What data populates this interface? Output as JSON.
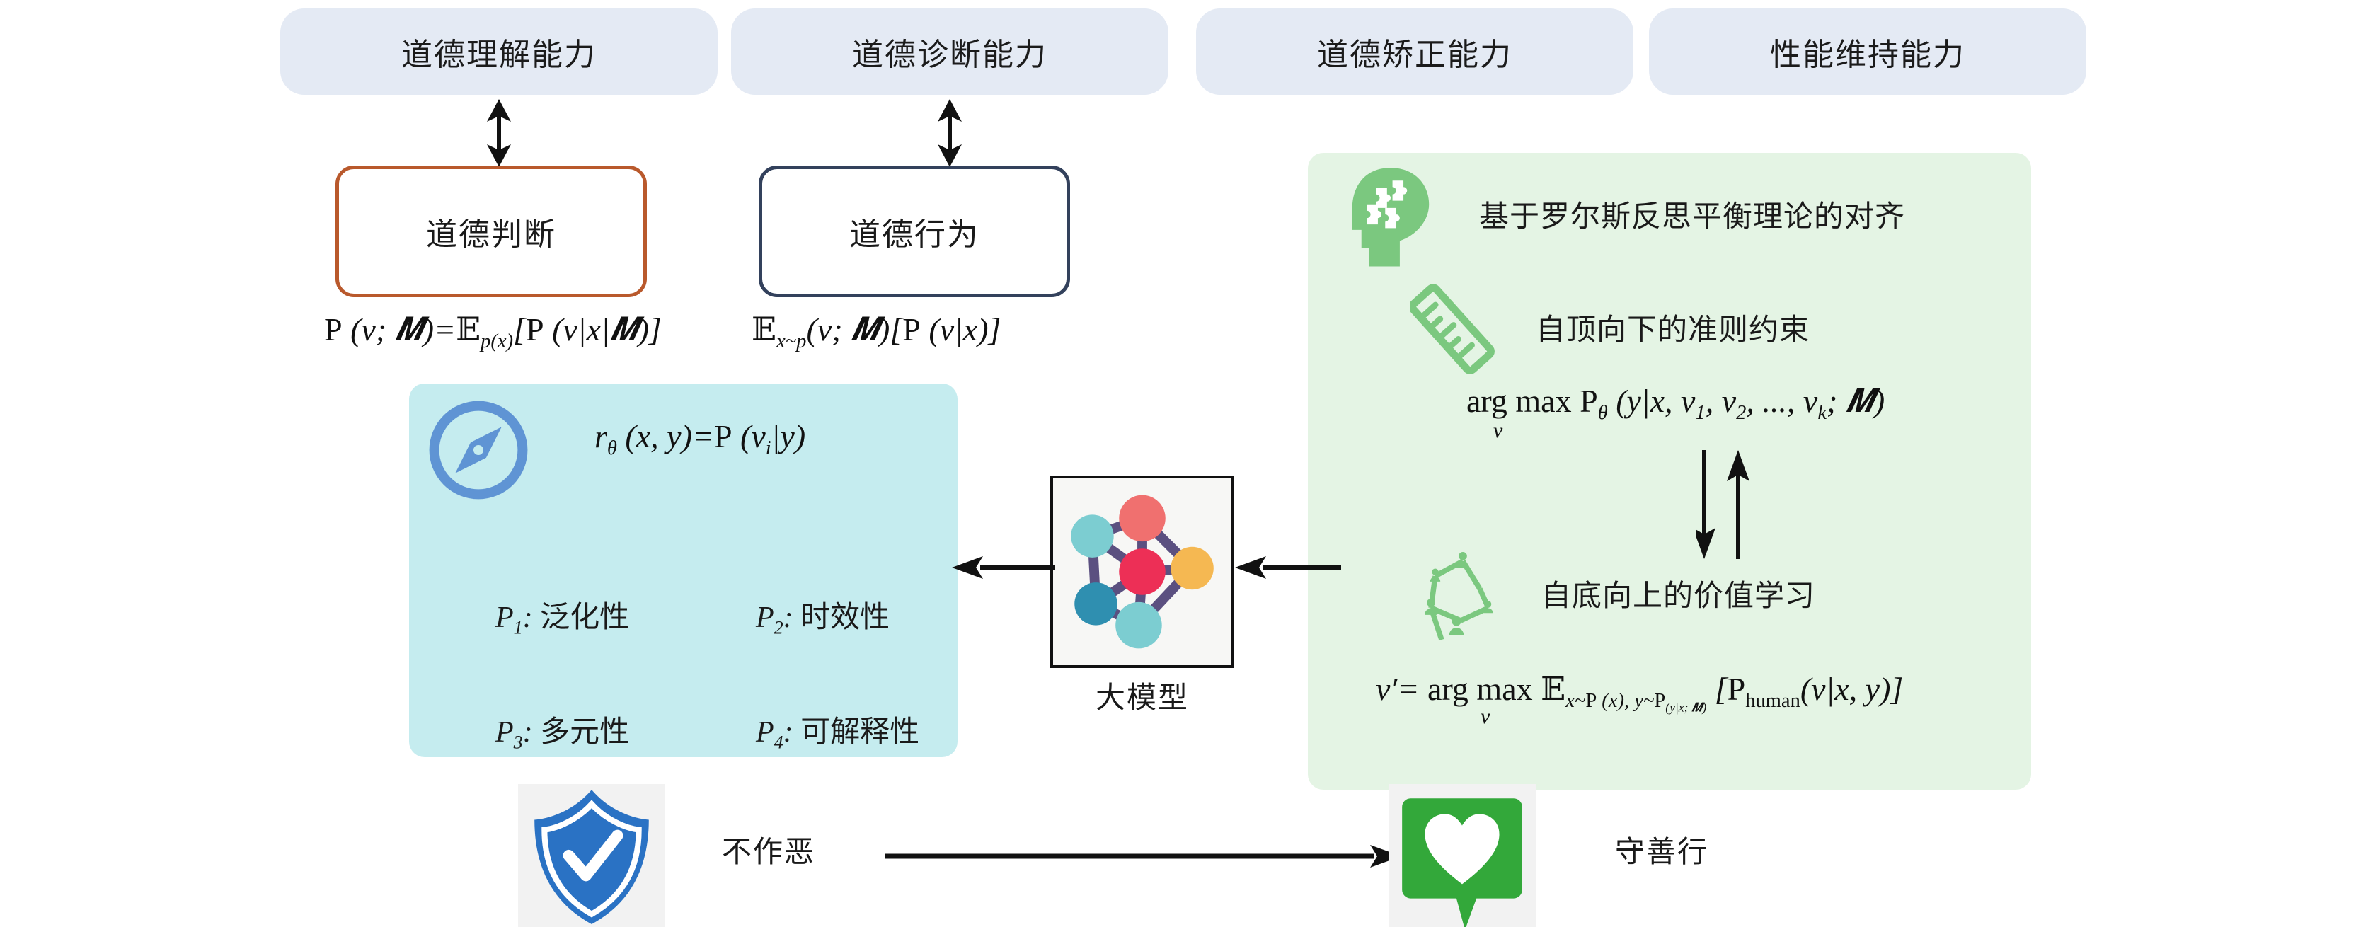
{
  "top_capabilities": [
    {
      "label": "道德理解能力"
    },
    {
      "label": "道德诊断能力"
    },
    {
      "label": "道德矫正能力"
    },
    {
      "label": "性能维持能力"
    }
  ],
  "concept_boxes": [
    {
      "label": "道德判断",
      "border_color": "#b9592c"
    },
    {
      "label": "道德行为",
      "border_color": "#33415c"
    }
  ],
  "formulas": {
    "moral_judgment": "P (v; M)=E_p(x)[P (v|x|M)]",
    "moral_behavior": "E_x~p(v; M)[P (v|x)]",
    "reward": "r_θ (x, y)=P (v_i|y)",
    "top_down": "arg max P_θ (y|x, v_1, v_2, ..., v_k; M)",
    "top_down_sub": "v",
    "bottom_up": "v′= arg max E_x~P (x), y~P_(y|x; M) [P_human(v|x, y)]",
    "bottom_up_sub": "v"
  },
  "principles_panel": {
    "icon": "compass-icon",
    "items": [
      {
        "key": "P1",
        "sub": "1",
        "label": "泛化性"
      },
      {
        "key": "P2",
        "sub": "2",
        "label": "时效性"
      },
      {
        "key": "P3",
        "sub": "3",
        "label": "多元性"
      },
      {
        "key": "P4",
        "sub": "4",
        "label": "可解释性"
      }
    ],
    "background": "#c5ecef"
  },
  "alignment_panel": {
    "background": "#e4f4e4",
    "heading": "基于罗尔斯反思平衡理论的对齐",
    "heading_icon": "brain-puzzle-head-icon",
    "top_down_title": "自顶向下的准则约束",
    "top_down_icon": "ruler-icon",
    "bottom_up_title": "自底向上的价值学习",
    "bottom_up_icon": "people-network-icon"
  },
  "llm": {
    "caption": "大模型",
    "icon": "neural-network-icon",
    "node_colors": [
      "#f0706f",
      "#7ccdd1",
      "#ed2f56",
      "#f5b852",
      "#2f8fb0",
      "#7ccdd1"
    ],
    "edge_color": "#5b5080"
  },
  "bottom_flow": {
    "left_icon": "shield-check-icon",
    "left_label": "不作恶",
    "right_icon": "heart-speech-bubble-icon",
    "right_label": "守善行"
  },
  "colors": {
    "pill_bg": "#e4eaf4",
    "orange": "#b9592c",
    "navy": "#33415c",
    "cyan_panel": "#c5ecef",
    "green_panel": "#e4f4e4",
    "green_icon": "#7bc87f",
    "blue_shield": "#2a72c4",
    "green_bubble": "#33a83a",
    "compass_blue": "#5f94d4"
  }
}
